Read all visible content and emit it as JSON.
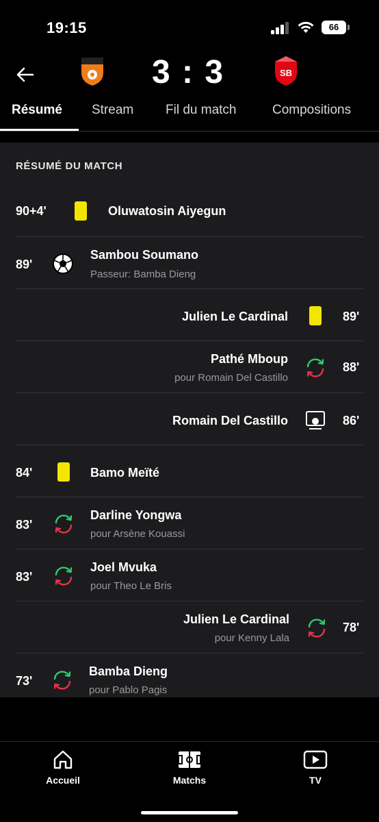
{
  "status_bar": {
    "time": "19:15",
    "battery": "66"
  },
  "match": {
    "home_crest_label": "FC LORIENT",
    "away_crest_label": "SB29",
    "score": "3 : 3"
  },
  "tabs": [
    {
      "label": "Résumé",
      "active": true
    },
    {
      "label": "Stream"
    },
    {
      "label": "Fil du match"
    },
    {
      "label": "Compositions"
    }
  ],
  "summary": {
    "title": "RÉSUMÉ DU MATCH",
    "events": [
      {
        "minute": "90+4'",
        "side": "home",
        "type": "yellow-card",
        "player": "Oluwatosin Aiyegun"
      },
      {
        "minute": "89'",
        "side": "home",
        "type": "goal",
        "player": "Sambou Soumano",
        "detail": "Passeur: Bamba Dieng"
      },
      {
        "minute": "89'",
        "side": "away",
        "type": "yellow-card",
        "player": "Julien Le Cardinal"
      },
      {
        "minute": "88'",
        "side": "away",
        "type": "substitution",
        "player": "Pathé Mboup",
        "detail": "pour Romain Del Castillo"
      },
      {
        "minute": "86'",
        "side": "away",
        "type": "var-goal",
        "player": "Romain Del Castillo"
      },
      {
        "minute": "84'",
        "side": "home",
        "type": "yellow-card",
        "player": "Bamo Meïté"
      },
      {
        "minute": "83'",
        "side": "home",
        "type": "substitution",
        "player": "Darline Yongwa",
        "detail": "pour Arsène Kouassi"
      },
      {
        "minute": "83'",
        "side": "home",
        "type": "substitution",
        "player": "Joel Mvuka",
        "detail": "pour Theo Le Bris"
      },
      {
        "minute": "78'",
        "side": "away",
        "type": "substitution",
        "player": "Julien Le Cardinal",
        "detail": "pour Kenny Lala"
      },
      {
        "minute": "73'",
        "side": "home",
        "type": "substitution",
        "player": "Bamba Dieng",
        "detail": "pour Pablo Pagis"
      }
    ]
  },
  "bottom_nav": [
    {
      "label": "Accueil",
      "icon": "home-icon"
    },
    {
      "label": "Matchs",
      "icon": "pitch-icon"
    },
    {
      "label": "TV",
      "icon": "play-icon"
    }
  ],
  "colors": {
    "background": "#000000",
    "card": "#1c1c1e",
    "yellow_card": "#f2e600",
    "sub_in": "#2ecc71",
    "sub_out": "#e8334a",
    "lorient_orange": "#f07d1a",
    "brest_red": "#e30613"
  }
}
